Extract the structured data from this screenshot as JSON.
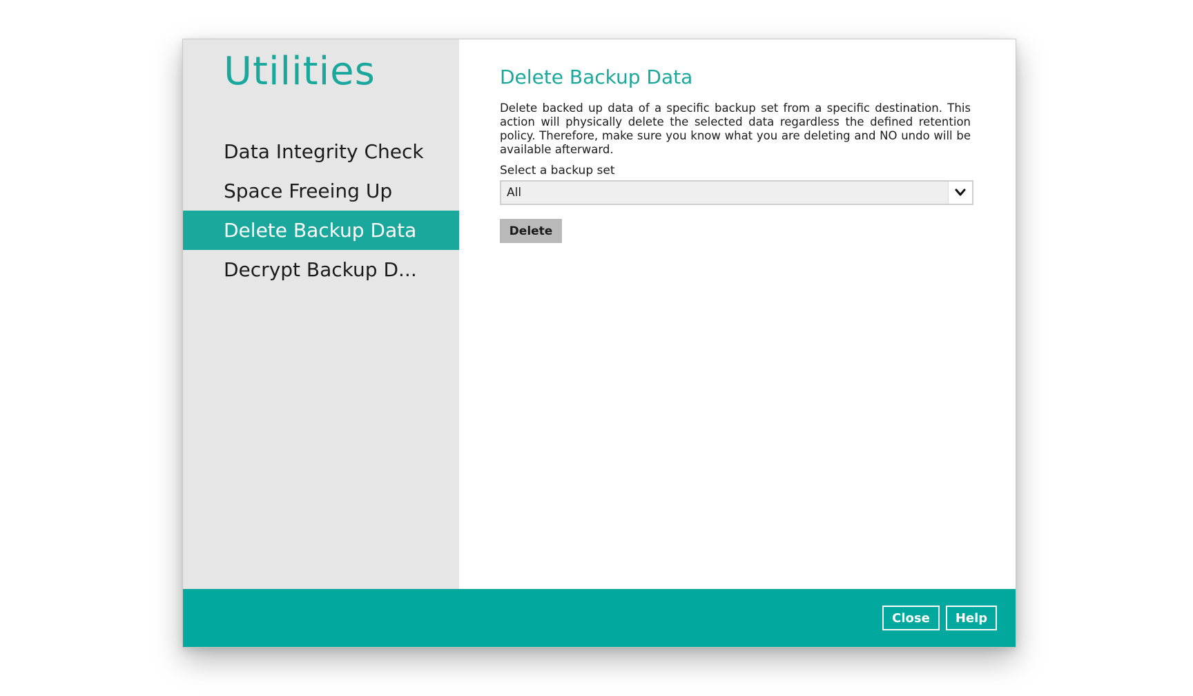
{
  "sidebar": {
    "title": "Utilities",
    "items": [
      {
        "label": "Data Integrity Check",
        "active": false
      },
      {
        "label": "Space Freeing Up",
        "active": false
      },
      {
        "label": "Delete Backup Data",
        "active": true
      },
      {
        "label": "Decrypt Backup D...",
        "active": false
      }
    ]
  },
  "main": {
    "title": "Delete Backup Data",
    "description": "Delete backed up data of a specific backup set from a specific destination. This action will physically delete the selected data regardless the defined retention policy. Therefore, make sure you know what you are deleting and NO undo will be available afterward.",
    "backup_set_label": "Select a backup set",
    "backup_set_value": "All",
    "delete_label": "Delete"
  },
  "footer": {
    "close_label": "Close",
    "help_label": "Help"
  },
  "colors": {
    "accent": "#1aa79c",
    "footer": "#00a89d",
    "sidebar_bg": "#e6e6e6"
  },
  "icons": {
    "select_arrow": "chevron-down-icon"
  }
}
